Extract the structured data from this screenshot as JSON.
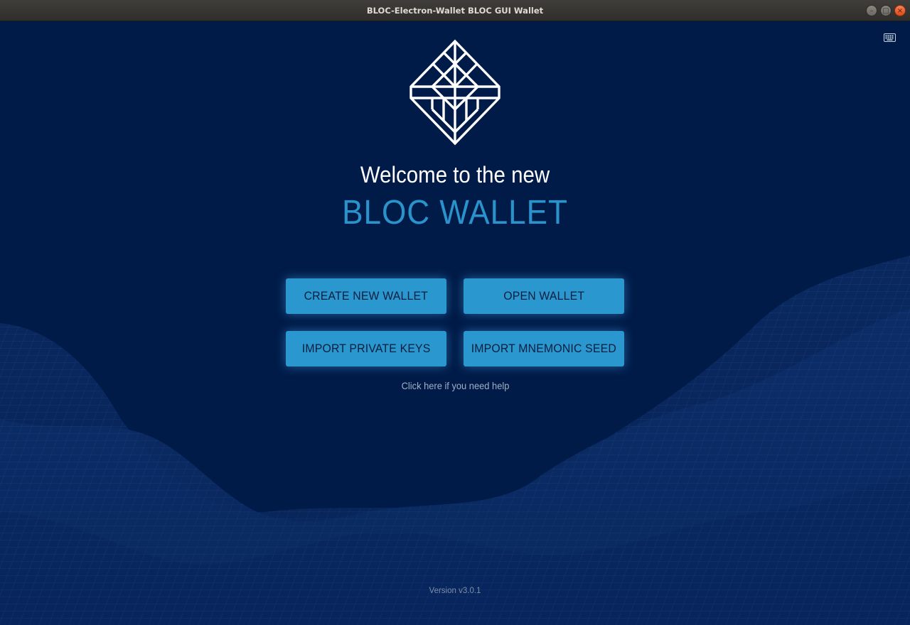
{
  "window": {
    "title": "BLOC-Electron-Wallet BLOC GUI Wallet",
    "controls": {
      "minimize_icon": "minimize-icon",
      "maximize_icon": "maximize-icon",
      "close_icon": "close-icon"
    }
  },
  "colors": {
    "background": "#001b48",
    "accent": "#2a93cc",
    "button": "#2a97cf",
    "button_text": "#0b1e3f"
  },
  "icons": {
    "keyboard": "keyboard-icon",
    "logo": "bloc-diamond-logo"
  },
  "main": {
    "welcome_text": "Welcome to the new",
    "brand_text": "BLOC WALLET",
    "buttons": {
      "create_wallet": "CREATE NEW WALLET",
      "open_wallet": "OPEN WALLET",
      "import_keys": "IMPORT PRIVATE KEYS",
      "import_seed": "IMPORT MNEMONIC SEED"
    },
    "help_link": "Click here if you need help",
    "version": "Version v3.0.1"
  }
}
